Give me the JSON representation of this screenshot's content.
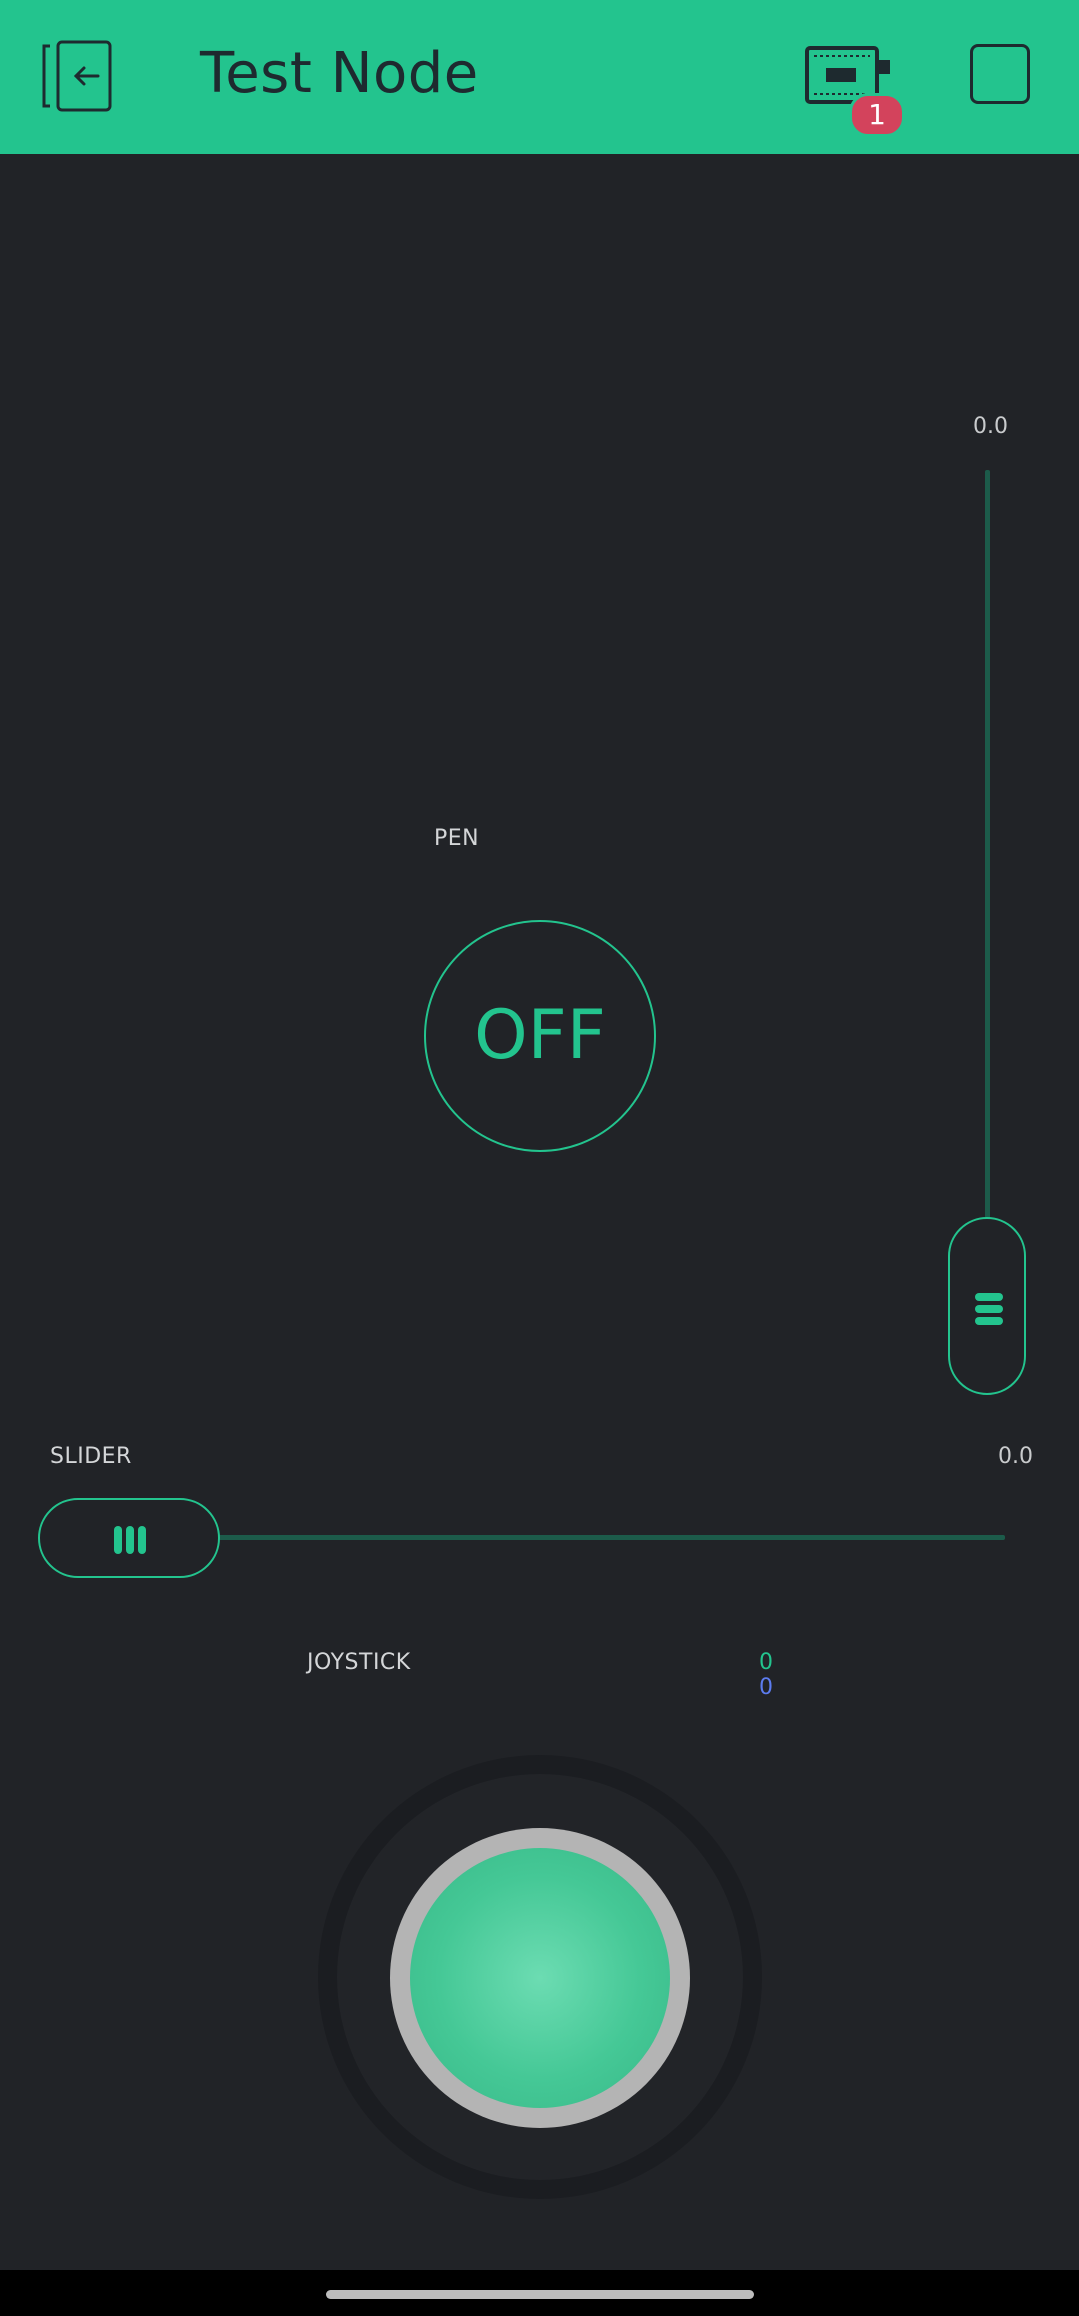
{
  "header": {
    "title": "Test Node",
    "notification_count": "1",
    "back_icon": "exit-app-icon",
    "device_icon": "device-board-icon",
    "stop_icon": "stop-square-icon"
  },
  "vertical_slider": {
    "value_text": "0.0",
    "level": 0
  },
  "pen": {
    "label": "PEN",
    "button_text": "OFF"
  },
  "slider": {
    "label": "SLIDER",
    "value_text": "0.0",
    "level": 0
  },
  "joystick": {
    "label": "JOYSTICK",
    "x_value": "0",
    "y_value": "0"
  },
  "colors": {
    "accent": "#23c48e",
    "background": "#212327",
    "badge": "#d3435c",
    "joystick_y": "#5c7cf0"
  }
}
